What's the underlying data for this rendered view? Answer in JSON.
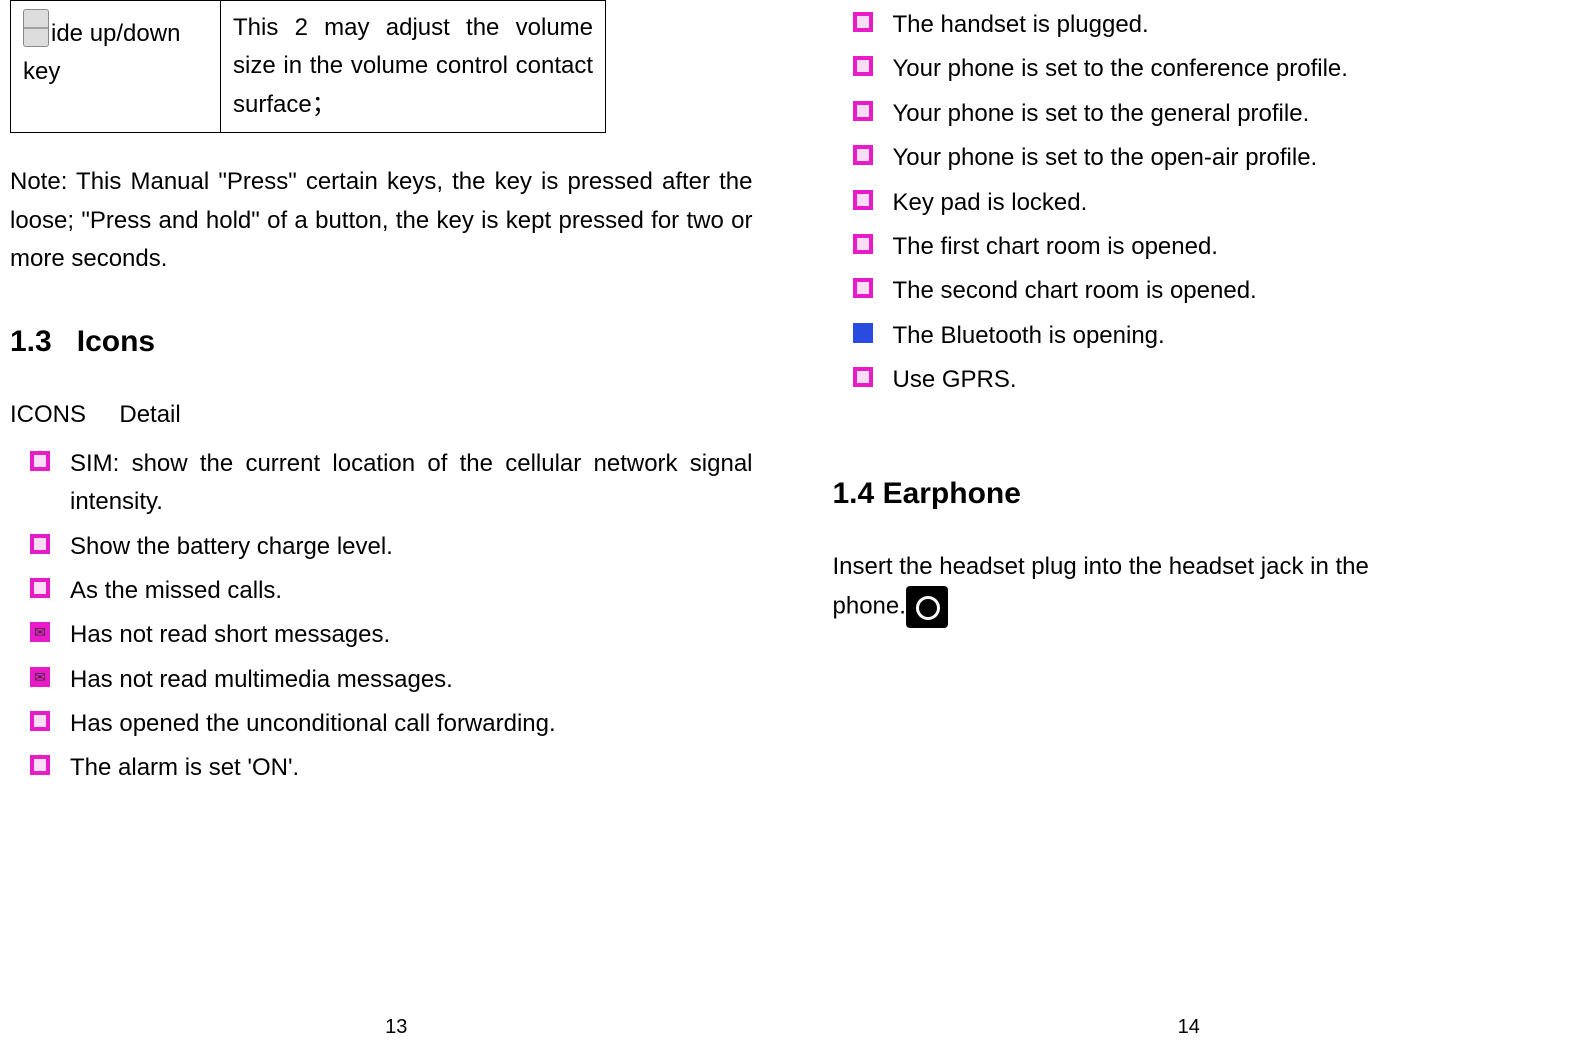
{
  "left": {
    "table": {
      "key_label": "ide up/down key",
      "key_desc": "This 2 may adjust the volume size in the volume control contact surface；"
    },
    "note": "Note: This Manual \"Press\" certain keys, the key is pressed after the loose; \"Press and hold\" of a button, the key is kept pressed for two or more seconds.",
    "section_num": "1.3",
    "section_title": "Icons",
    "icons_head_left": "ICONS",
    "icons_head_right": "Detail",
    "items": [
      "SIM: show the current location of the cellular network signal intensity.",
      "Show the battery charge level.",
      "As the missed calls.",
      "Has not read short messages.",
      "Has not read multimedia messages.",
      "Has opened the unconditional call forwarding.",
      "The alarm is set 'ON'."
    ],
    "page_num": "13"
  },
  "right": {
    "items": [
      "The handset is plugged.",
      "Your phone is set to the conference profile.",
      "Your phone is set to the general profile.",
      "Your phone is set to the open-air profile.",
      "Key pad is locked.",
      "The first chart room is opened.",
      "The second chart room is opened.",
      "The Bluetooth is opening.",
      "Use GPRS."
    ],
    "section_num": "1.4",
    "section_title": "Earphone",
    "earphone_text_a": "Insert the headset plug into the headset jack in the",
    "earphone_text_b": "phone.",
    "page_num": "14"
  }
}
